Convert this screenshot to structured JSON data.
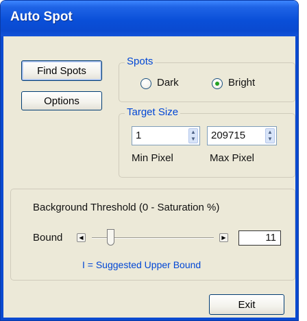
{
  "window": {
    "title": "Auto Spot"
  },
  "buttons": {
    "find_spots": "Find Spots",
    "options": "Options",
    "exit": "Exit"
  },
  "spots": {
    "legend": "Spots",
    "options": [
      {
        "label": "Dark",
        "selected": false
      },
      {
        "label": "Bright",
        "selected": true
      }
    ]
  },
  "target_size": {
    "legend": "Target Size",
    "min": {
      "value": "1",
      "caption": "Min Pixel"
    },
    "max": {
      "value": "209715",
      "caption": "Max Pixel"
    }
  },
  "threshold": {
    "label": "Background Threshold (0 - Saturation %)",
    "bound_label": "Bound",
    "value": "11",
    "hint": "I = Suggested Upper Bound"
  },
  "icons": {
    "spin_up": "up-arrow-icon",
    "spin_down": "down-arrow-icon",
    "slider_left": "left-arrow-icon",
    "slider_right": "right-arrow-icon"
  },
  "colors": {
    "title_bar": "#0a4ad0",
    "group_legend": "#0046d5",
    "radio_selected": "#23a123",
    "suggested_marker": "#0a2fd0"
  }
}
